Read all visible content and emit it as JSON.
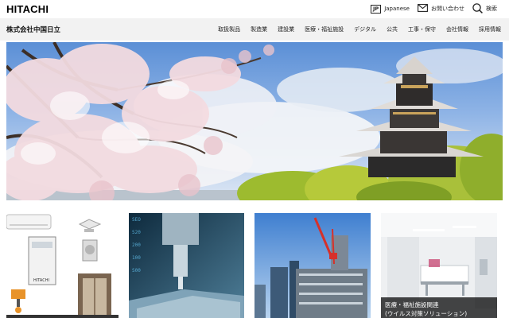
{
  "header": {
    "logo": "HITACHI",
    "language": {
      "badge": "JP",
      "label": "Japanese"
    },
    "contact_label": "お問い合わせ",
    "search_label": "検索"
  },
  "nav": {
    "company_name": "株式会社中国日立",
    "items": [
      "取扱製品",
      "製造業",
      "建設業",
      "医療・福祉施設",
      "デジタル",
      "公共",
      "工事・保守",
      "会社情報",
      "採用情報"
    ]
  },
  "cards": [
    {
      "caption": ""
    },
    {
      "caption": ""
    },
    {
      "caption": ""
    },
    {
      "caption": "医療・福祉施設関連",
      "caption_sub": "(ウイルス対策ソリューション)"
    }
  ],
  "colors": {
    "nav_bg": "#f2f2f2",
    "text": "#222222",
    "caption_bg": "#000000"
  }
}
